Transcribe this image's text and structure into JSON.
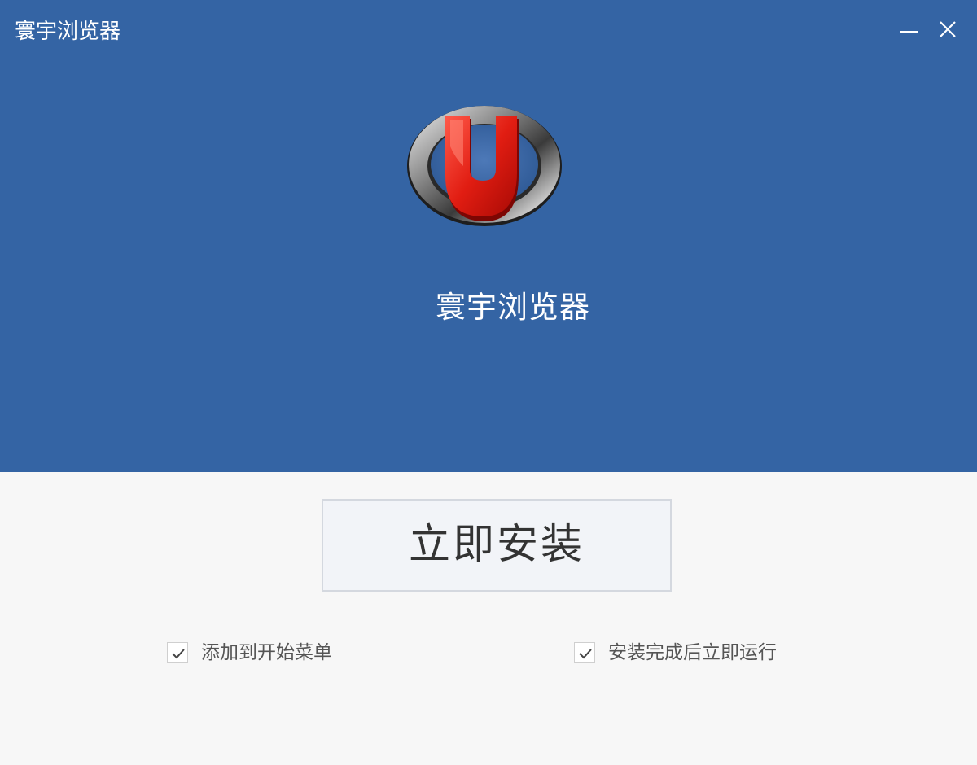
{
  "window": {
    "title": "寰宇浏览器",
    "minimize_icon": "minimize-icon",
    "close_icon": "close-icon"
  },
  "header": {
    "logo_icon": "browser-logo-icon",
    "product_name": "寰宇浏览器",
    "background_color": "#3464a4"
  },
  "install": {
    "button_label": "立即安装"
  },
  "options": [
    {
      "label": "添加到开始菜单",
      "checked": true
    },
    {
      "label": "安装完成后立即运行",
      "checked": true
    }
  ]
}
